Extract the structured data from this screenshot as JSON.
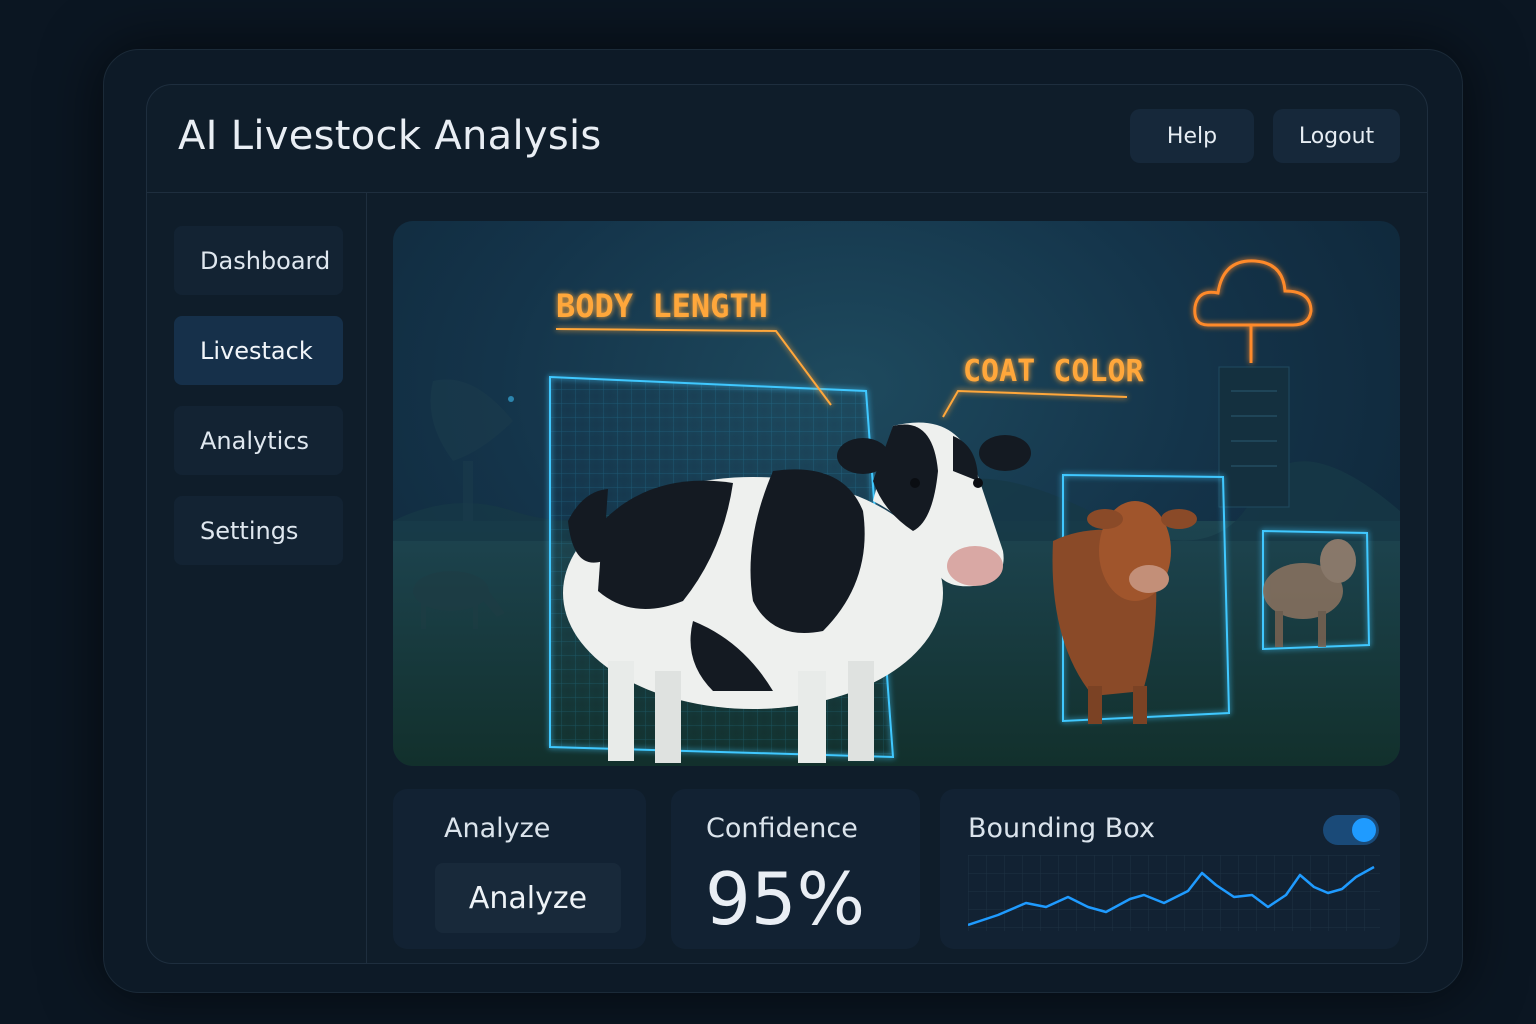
{
  "app": {
    "title": "AI Livestock Analysis"
  },
  "header": {
    "help_label": "Help",
    "logout_label": "Logout"
  },
  "sidebar": {
    "items": [
      {
        "label": "Dashboard"
      },
      {
        "label": "Livestack",
        "active": true
      },
      {
        "label": "Analytics"
      },
      {
        "label": "Settings"
      }
    ]
  },
  "hero": {
    "annotations": {
      "body_length": "BODY LENGTH",
      "coat_color": "COAT COLOR"
    }
  },
  "controls": {
    "analyze": {
      "label": "Analyze",
      "button_label": "Analyze"
    },
    "confidence": {
      "label": "Confidence",
      "value": "95%"
    },
    "bounding_box": {
      "label": "Bounding Box",
      "enabled": true
    }
  },
  "colors": {
    "accent_blue": "#1f9bff",
    "annotation_orange": "#ffa73a",
    "bounding_box_cyan": "#3fc8ff"
  }
}
